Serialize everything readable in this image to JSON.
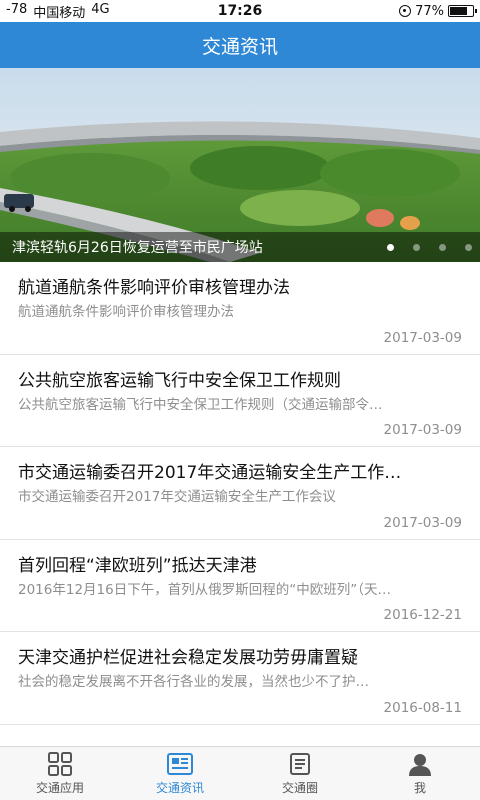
{
  "status_bar": {
    "signal": "-78",
    "carrier": "中国移动",
    "network": "4G",
    "time": "17:26",
    "battery_text": "77%",
    "battery_level": 0.77
  },
  "header": {
    "title": "交通资讯"
  },
  "banner": {
    "caption": "津滨轻轨6月26日恢复运营至市民广场站",
    "slide_count": 4,
    "active_slide": 1
  },
  "news": [
    {
      "title": "航道通航条件影响评价审核管理办法",
      "summary": "航道通航条件影响评价审核管理办法",
      "date": "2017-03-09"
    },
    {
      "title": "公共航空旅客运输飞行中安全保卫工作规则",
      "summary": "公共航空旅客运输飞行中安全保卫工作规则（交通运输部令…",
      "date": "2017-03-09"
    },
    {
      "title": "市交通运输委召开2017年交通运输安全生产工作…",
      "summary": "市交通运输委召开2017年交通运输安全生产工作会议",
      "date": "2017-03-09"
    },
    {
      "title": "首列回程“津欧班列”抵达天津港",
      "summary": "2016年12月16日下午，首列从俄罗斯回程的“中欧班列”（天…",
      "date": "2016-12-21"
    },
    {
      "title": "天津交通护栏促进社会稳定发展功劳毋庸置疑",
      "summary": "社会的稳定发展离不开各行各业的发展，当然也少不了护…",
      "date": "2016-08-11"
    }
  ],
  "tabs": [
    {
      "label": "交通应用",
      "icon": "grid-icon"
    },
    {
      "label": "交通资讯",
      "icon": "news-icon"
    },
    {
      "label": "交通圈",
      "icon": "circle-icon"
    },
    {
      "label": "我",
      "icon": "person-icon"
    }
  ],
  "colors": {
    "accent": "#2f88d5",
    "text_secondary": "#8e8e8e"
  }
}
